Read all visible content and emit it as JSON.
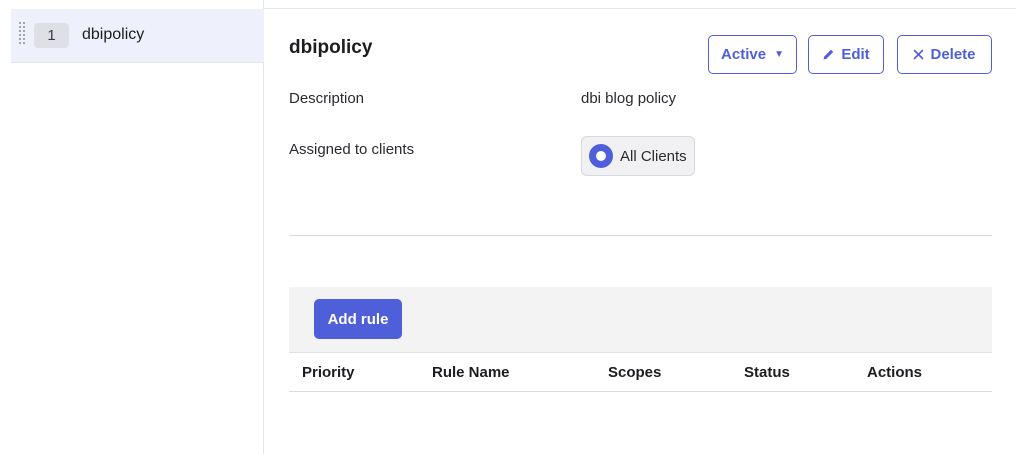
{
  "sidebar": {
    "policies": [
      {
        "priority": "1",
        "name": "dbipolicy"
      }
    ]
  },
  "policy": {
    "title": "dbipolicy",
    "status_label": "Active",
    "edit_label": "Edit",
    "delete_label": "Delete",
    "description_label": "Description",
    "description_value": "dbi blog policy",
    "assigned_label": "Assigned to clients",
    "assigned_value": "All Clients"
  },
  "rules": {
    "add_label": "Add rule",
    "columns": [
      "Priority",
      "Rule Name",
      "Scopes",
      "Status",
      "Actions"
    ]
  },
  "colors": {
    "accent": "#4f5fd9",
    "selected_bg": "#eef0fb"
  }
}
